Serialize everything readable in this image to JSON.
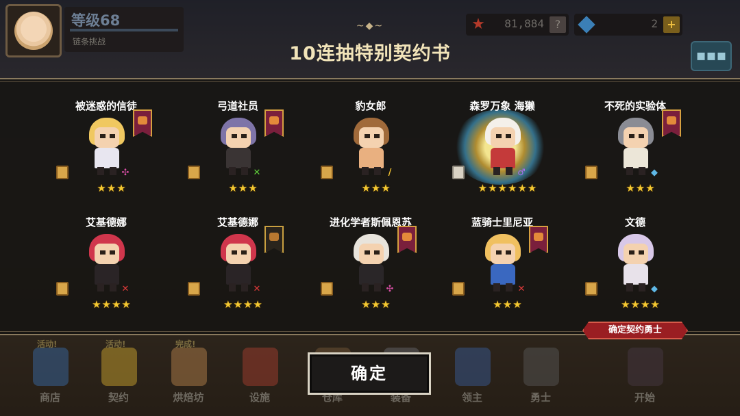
{
  "player": {
    "level_label": "等级68",
    "subtitle": "链条挑战"
  },
  "resources": {
    "gold": "81,884",
    "gold_btn": "?",
    "gems": "2",
    "gems_btn": "+"
  },
  "panel": {
    "title": "10连抽特别契约书",
    "ornament": "~◆~"
  },
  "cards": [
    {
      "name": "被迷惑的信徒",
      "stars": "★★★",
      "banner": "guild",
      "scroll": "gold",
      "weapon_icon": "mace-icon",
      "weapon_glyph": "✣",
      "weapon_color": "#d94fa6",
      "hair": "#f0c860",
      "body": "#e8e6f0"
    },
    {
      "name": "弓道社员",
      "stars": "★★★",
      "banner": "guild",
      "scroll": "gold",
      "weapon_icon": "bow-icon",
      "weapon_glyph": "✕",
      "weapon_color": "#5fcf3a",
      "hair": "#7e74a8",
      "body": "#3a3434"
    },
    {
      "name": "豹女郎",
      "stars": "★★★",
      "banner": "none",
      "scroll": "gold",
      "weapon_icon": "sword-icon",
      "weapon_glyph": "/",
      "weapon_color": "#f0c030",
      "hair": "#a06a3a",
      "body": "#e9b080"
    },
    {
      "name": "森罗万象 海獭",
      "stars": "★★★★★★",
      "banner": "none",
      "scroll": "plain",
      "weapon_icon": "staff-icon",
      "weapon_glyph": "♂",
      "weapon_color": "#a86ff0",
      "hair": "#f4f0ea",
      "body": "#c43a3a"
    },
    {
      "name": "不死的实验体",
      "stars": "★★★",
      "banner": "guild",
      "scroll": "gold",
      "weapon_icon": "axe-icon",
      "weapon_glyph": "◆",
      "weapon_color": "#5fb8e6",
      "hair": "#8a8c94",
      "body": "#ece6d8"
    },
    {
      "name": "艾基德娜",
      "stars": "★★★★",
      "banner": "none",
      "scroll": "gold",
      "weapon_icon": "dagger-icon",
      "weapon_glyph": "✕",
      "weapon_color": "#e03a3a",
      "hair": "#d0364c",
      "body": "#2a2426"
    },
    {
      "name": "艾基德娜",
      "stars": "★★★★",
      "banner": "dark",
      "scroll": "gold",
      "weapon_icon": "dagger-icon",
      "weapon_glyph": "✕",
      "weapon_color": "#e03a3a",
      "hair": "#d0364c",
      "body": "#2a2426"
    },
    {
      "name": "进化学者斯佩恩苏",
      "stars": "★★★",
      "banner": "guild",
      "scroll": "gold",
      "weapon_icon": "mace-icon",
      "weapon_glyph": "✣",
      "weapon_color": "#d94fa6",
      "hair": "#e8e4dc",
      "body": "#2a2628"
    },
    {
      "name": "蓝骑士里尼亚",
      "stars": "★★★",
      "banner": "guild",
      "scroll": "gold",
      "weapon_icon": "dagger-icon",
      "weapon_glyph": "✕",
      "weapon_color": "#e03a3a",
      "hair": "#f0c060",
      "body": "#3a68c0"
    },
    {
      "name": "文德",
      "stars": "★★★★",
      "banner": "none",
      "scroll": "gold",
      "weapon_icon": "axe-icon",
      "weapon_glyph": "◆",
      "weapon_color": "#5fb8e6",
      "hair": "#d8c8e8",
      "body": "#e8e2ea"
    }
  ],
  "confirm_tag": "确定契约勇士",
  "ok_button": "确定",
  "nav": [
    {
      "label": "商店",
      "badge": "活动!",
      "color": "#3a6fb0"
    },
    {
      "label": "契约",
      "badge": "活动!",
      "color": "#d9b030"
    },
    {
      "label": "烘焙坊",
      "badge": "完成!",
      "color": "#c08a50"
    },
    {
      "label": "设施",
      "badge": "",
      "color": "#b04030"
    },
    {
      "label": "仓库",
      "badge": "",
      "color": "#7a5a3a"
    },
    {
      "label": "装备",
      "badge": "",
      "color": "#6a6a70"
    },
    {
      "label": "领主",
      "badge": "",
      "color": "#3a5fa0"
    },
    {
      "label": "勇士",
      "badge": "",
      "color": "#5a5a5a"
    },
    {
      "label": "开始",
      "badge": "",
      "color": "#4a3a48"
    }
  ]
}
